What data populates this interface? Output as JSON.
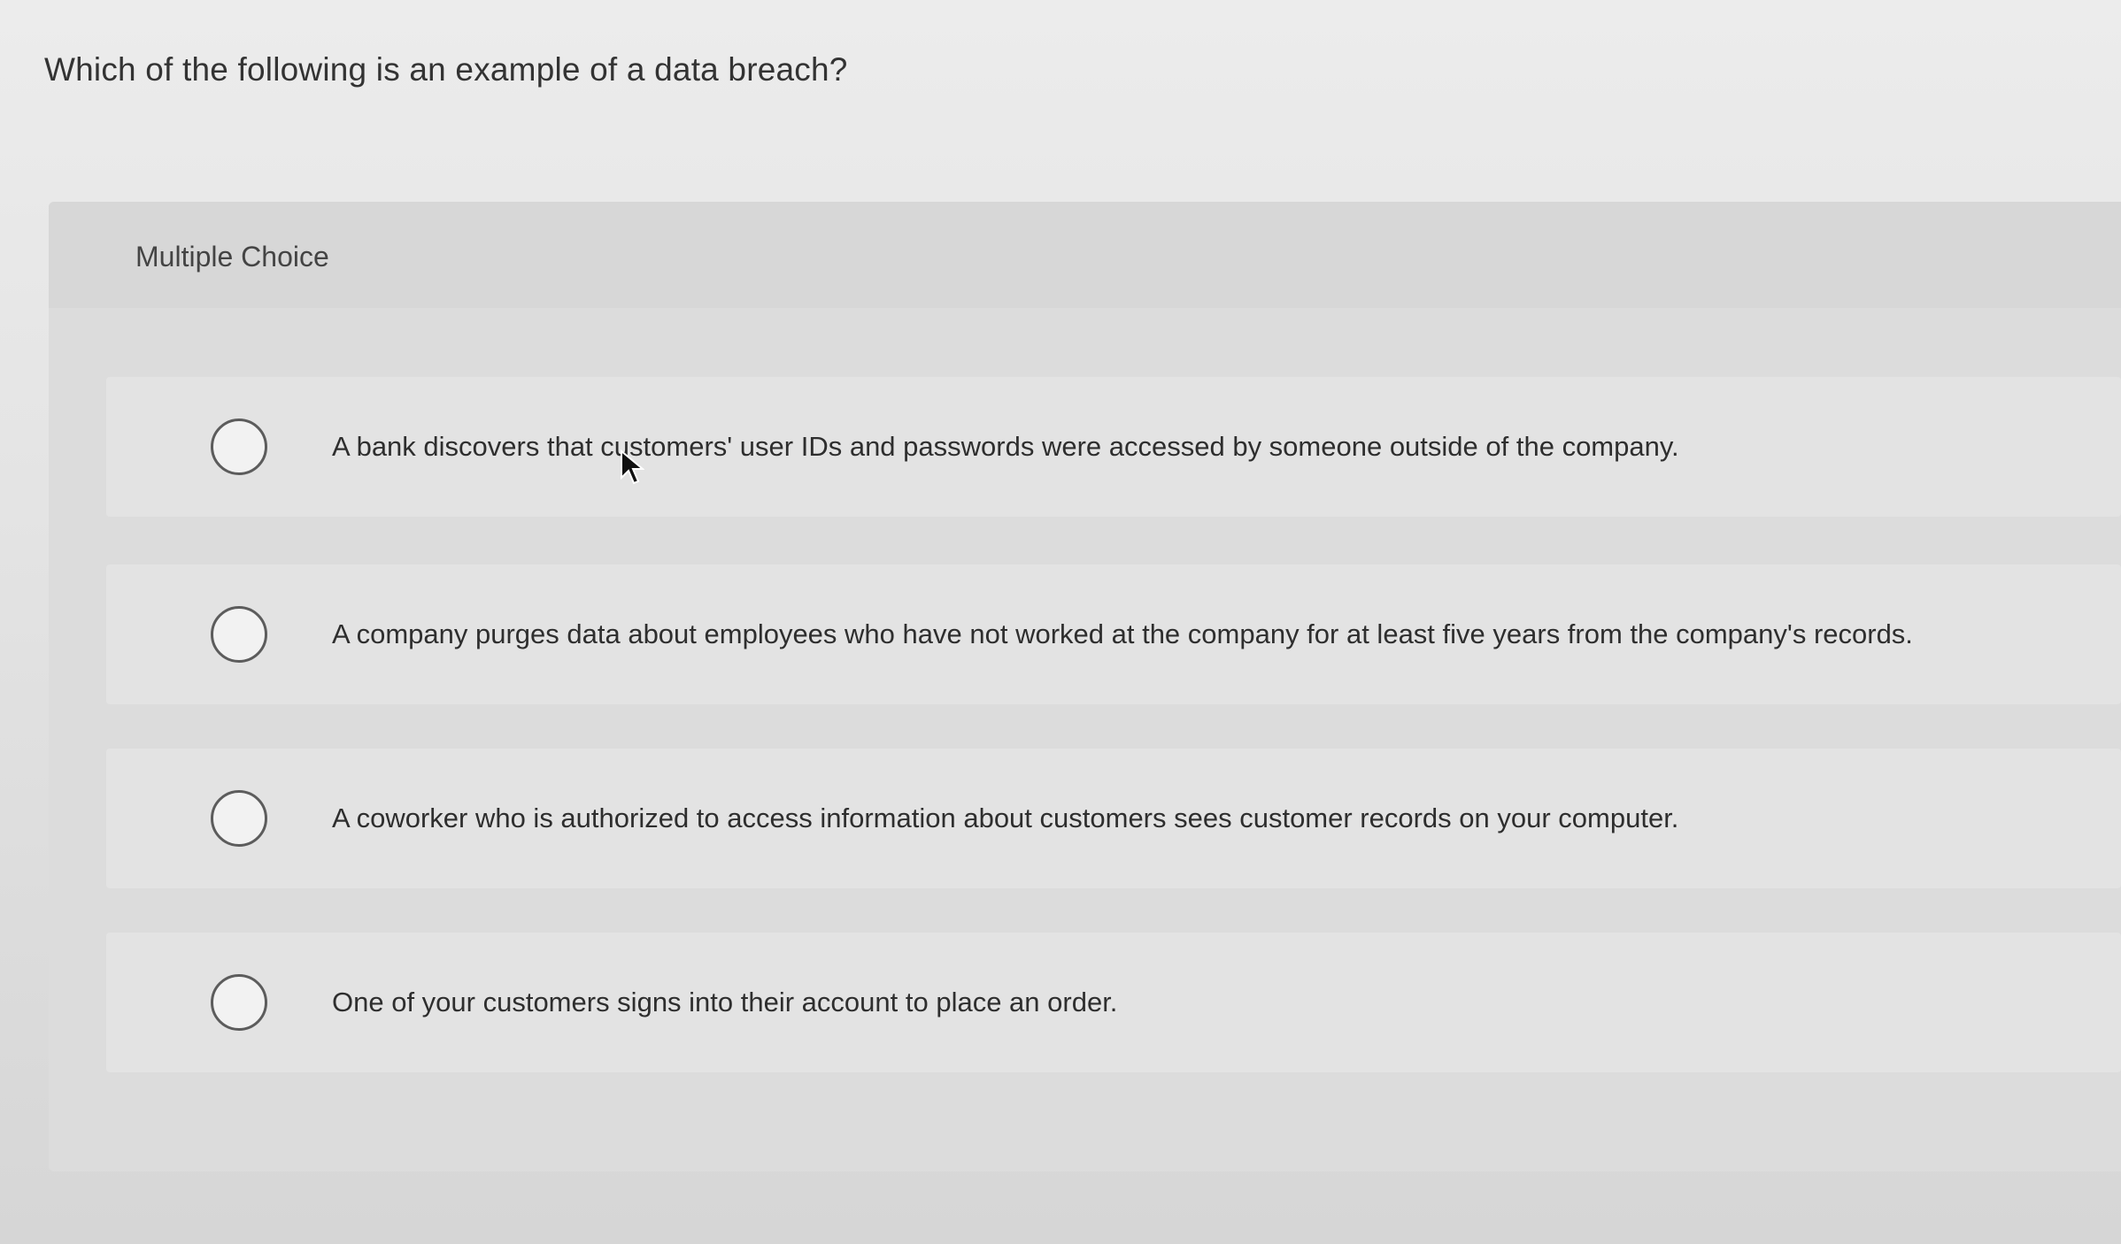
{
  "question": "Which of the following is an example of a data breach?",
  "panel_label": "Multiple Choice",
  "options": [
    {
      "text": "A bank discovers that customers' user IDs and passwords were accessed by someone outside of the company."
    },
    {
      "text": "A company purges data about employees who have not worked at the company for at least five years from the company's records."
    },
    {
      "text": "A coworker who is authorized to access information about customers sees customer records on your computer."
    },
    {
      "text": "One of your customers signs into their account to place an order."
    }
  ],
  "icons": {
    "radio": "radio-unselected-icon",
    "cursor": "mouse-pointer-icon"
  }
}
